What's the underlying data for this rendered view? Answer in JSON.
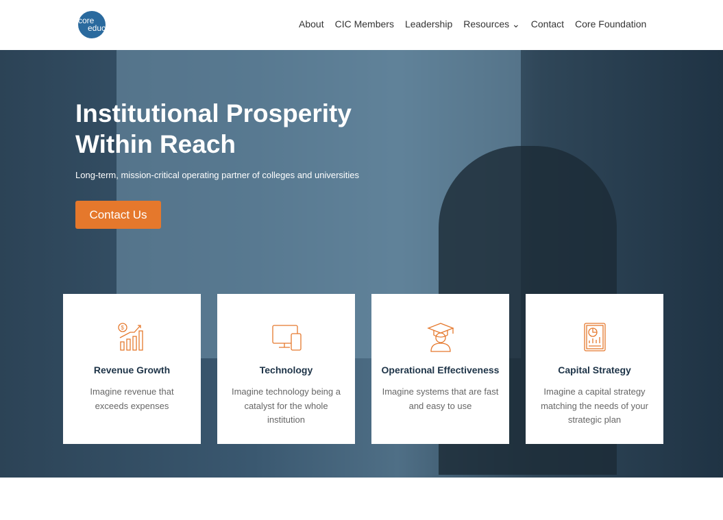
{
  "logo": {
    "line1": "core",
    "line2": "education"
  },
  "nav": [
    "About",
    "CIC Members",
    "Leadership",
    "Resources ⌄",
    "Contact",
    "Core Foundation"
  ],
  "hero": {
    "title_line1": "Institutional Prosperity",
    "title_line2": "Within Reach",
    "subtitle": "Long-term, mission-critical operating partner of colleges and universities",
    "cta": "Contact Us"
  },
  "cards": [
    {
      "title": "Revenue Growth",
      "text": "Imagine revenue that exceeds expenses",
      "icon": "revenue-growth-icon"
    },
    {
      "title": "Technology",
      "text": "Imagine technology being a catalyst for the whole institution",
      "icon": "devices-icon"
    },
    {
      "title": "Operational Effectiveness",
      "text": "Imagine systems that are fast and easy to use",
      "icon": "graduate-icon"
    },
    {
      "title": "Capital Strategy",
      "text": "Imagine a capital strategy matching the needs of your strategic plan",
      "icon": "report-icon"
    }
  ],
  "colors": {
    "accent": "#e5782c",
    "brand": "#2a6a9e"
  }
}
